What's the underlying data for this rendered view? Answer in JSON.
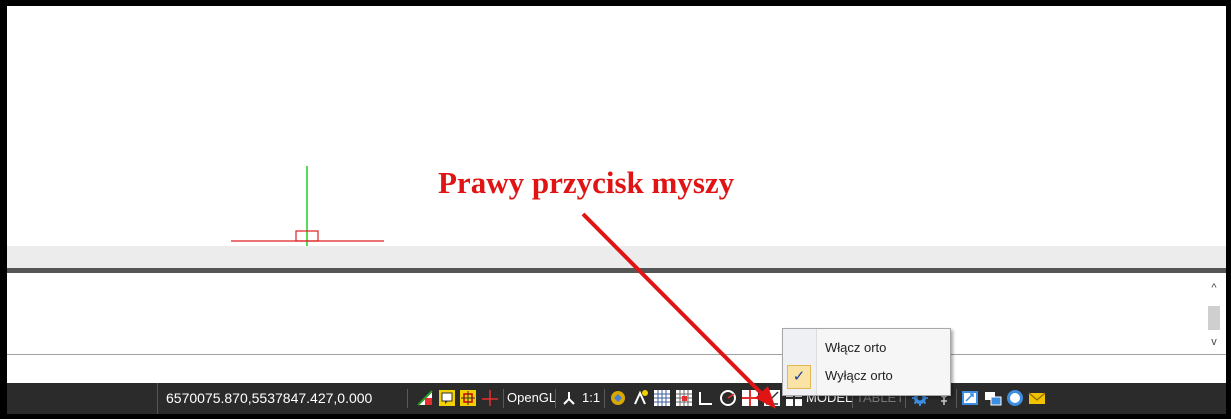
{
  "annotation": {
    "text": "Prawy przycisk myszy",
    "color": "#e01414"
  },
  "status_bar": {
    "coordinates": "6570075.870,5537847.427,0.000",
    "opengl_label": "OpenGL",
    "scale_label": "1:1",
    "model_label": "MODEL",
    "tablet_label": "TABLET"
  },
  "context_menu": {
    "items": [
      {
        "label": "Włącz orto",
        "checked": false
      },
      {
        "label": "Wyłącz orto",
        "checked": true
      }
    ],
    "check_glyph": "✓"
  },
  "scrollbar": {
    "up_glyph": "^",
    "down_glyph": "v"
  },
  "icons": {
    "ucs_icon": "ucs-icon",
    "settings_icon": "gear-icon",
    "mail_icon": "mail-icon"
  }
}
